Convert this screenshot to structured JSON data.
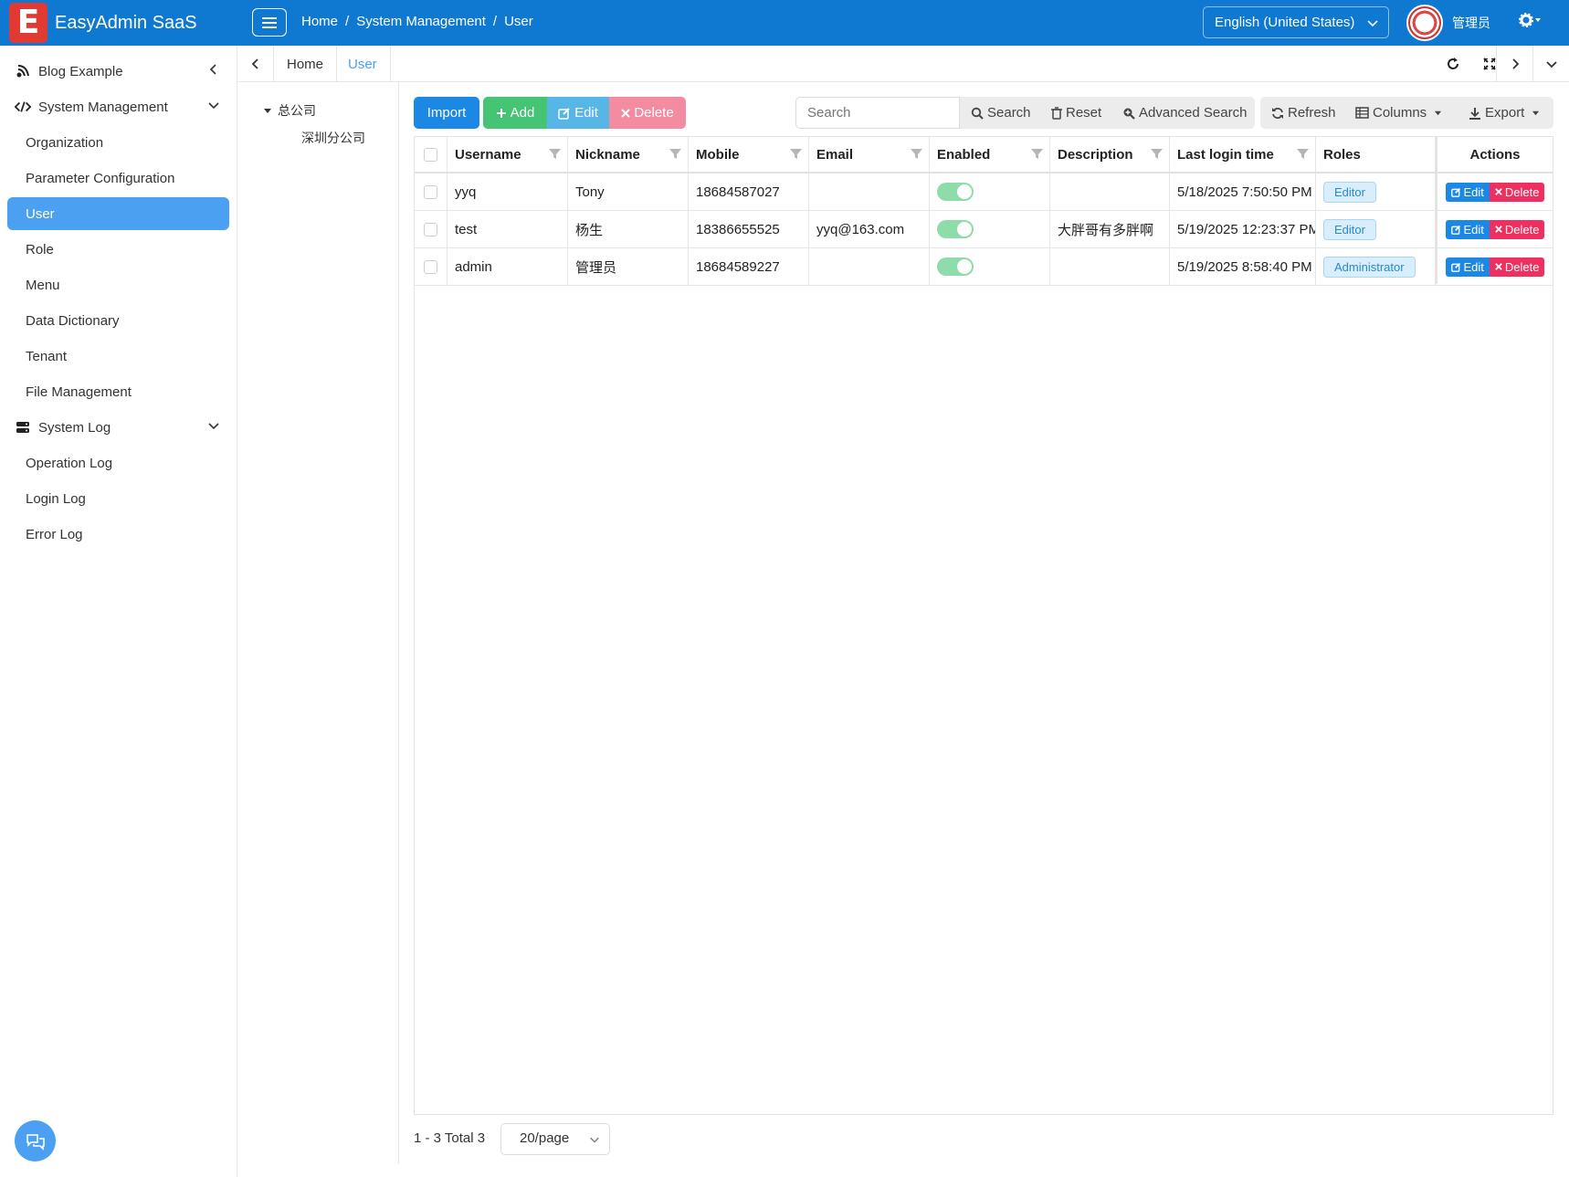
{
  "header": {
    "logo_letter": "E",
    "app_title": "EasyAdmin SaaS",
    "breadcrumb": [
      "Home",
      "System Management",
      "User"
    ],
    "language": "English (United States)",
    "user_name": "管理员"
  },
  "sidebar": {
    "items": [
      {
        "label": "Blog Example",
        "type": "group",
        "icon": "blog-icon"
      },
      {
        "label": "System Management",
        "type": "group",
        "icon": "code-icon"
      },
      {
        "label": "Organization",
        "type": "sub"
      },
      {
        "label": "Parameter Configuration",
        "type": "sub"
      },
      {
        "label": "User",
        "type": "sub",
        "active": true
      },
      {
        "label": "Role",
        "type": "sub"
      },
      {
        "label": "Menu",
        "type": "sub"
      },
      {
        "label": "Data Dictionary",
        "type": "sub"
      },
      {
        "label": "Tenant",
        "type": "sub"
      },
      {
        "label": "File Management",
        "type": "sub"
      },
      {
        "label": "System Log",
        "type": "group",
        "icon": "server-icon"
      },
      {
        "label": "Operation Log",
        "type": "sub"
      },
      {
        "label": "Login Log",
        "type": "sub"
      },
      {
        "label": "Error Log",
        "type": "sub"
      }
    ]
  },
  "tabs": [
    {
      "label": "Home",
      "active": false
    },
    {
      "label": "User",
      "active": true
    }
  ],
  "tree": {
    "root": "总公司",
    "children": [
      "深圳分公司"
    ]
  },
  "toolbar": {
    "import_label": "Import",
    "add_label": "Add",
    "edit_label": "Edit",
    "delete_label": "Delete",
    "search_placeholder": "Search",
    "search_label": "Search",
    "reset_label": "Reset",
    "advanced_search_label": "Advanced Search",
    "refresh_label": "Refresh",
    "columns_label": "Columns",
    "export_label": "Export"
  },
  "table": {
    "columns": [
      "Username",
      "Nickname",
      "Mobile",
      "Email",
      "Enabled",
      "Description",
      "Last login time",
      "Roles",
      "Actions"
    ],
    "rows": [
      {
        "username": "yyq",
        "nickname": "Tony",
        "mobile": "18684587027",
        "email": "",
        "enabled": true,
        "description": "",
        "last_login": "5/18/2025 7:50:50 PM",
        "role": "Editor"
      },
      {
        "username": "test",
        "nickname": "杨生",
        "mobile": "18386655525",
        "email": "yyq@163.com",
        "enabled": true,
        "description": "大胖哥有多胖啊",
        "last_login": "5/19/2025 12:23:37 PM",
        "role": "Editor"
      },
      {
        "username": "admin",
        "nickname": "管理员",
        "mobile": "18684589227",
        "email": "",
        "enabled": true,
        "description": "",
        "last_login": "5/19/2025 8:58:40 PM",
        "role": "Administrator"
      }
    ],
    "row_edit_label": "Edit",
    "row_delete_label": "Delete"
  },
  "pagination": {
    "summary": "1 - 3 Total 3",
    "page_size": "20/page"
  },
  "colors": {
    "header_bg": "#0f78d1",
    "active_nav": "#4ba0f1",
    "primary": "#1b88e6",
    "success": "#45c474",
    "info": "#56b6e6",
    "danger": "#ef2f5f"
  }
}
